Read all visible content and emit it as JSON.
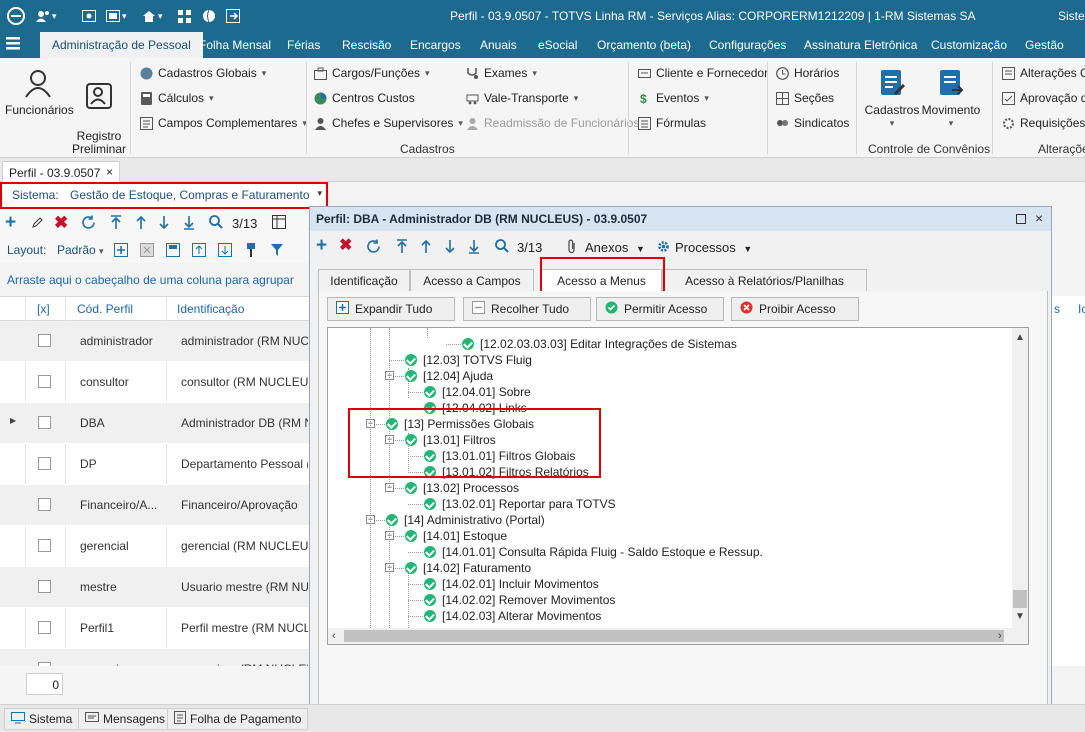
{
  "app": {
    "window_title": "Perfil - 03.9.0507 - TOTVS Linha RM - Serviços  Alias: CORPORERM1212209 | 1-RM Sistemas SA",
    "right_title": "Sister"
  },
  "menubar": {
    "items": [
      "Administração de Pessoal",
      "Folha Mensal",
      "Férias",
      "Rescisão",
      "Encargos",
      "Anuais",
      "eSocial",
      "Orçamento (beta)",
      "Configurações",
      "Assinatura Eletrônica",
      "Customização",
      "Gestão"
    ],
    "active": "Administração de Pessoal"
  },
  "ribbon": {
    "funcionarios": "Funcionários",
    "registro": "Registro\nPreliminar",
    "cadastros_globais": "Cadastros Globais",
    "calculos": "Cálculos",
    "campos_complementares": "Campos Complementares",
    "cargos": "Cargos/Funções",
    "centros_custos": "Centros Custos",
    "chefes": "Chefes e Supervisores",
    "exames": "Exames",
    "vale_transporte": "Vale-Transporte",
    "readmissao": "Readmissão de Funcionários",
    "cliente_fornecedor": "Cliente e Fornecedor",
    "eventos": "Eventos",
    "formulas": "Fórmulas",
    "horarios": "Horários",
    "secoes": "Seções",
    "sindicatos": "Sindicatos",
    "cadastros_big": "Cadastros",
    "movimento_big": "Movimento",
    "alteracoes_ca": "Alterações Ca",
    "aprovacao": "Aprovação de",
    "requisicoes": "Requisições",
    "group_cadastros": "Cadastros",
    "group_convenios": "Controle de Convênios",
    "group_alteracoes": "Alteraçõe"
  },
  "doc_tab": {
    "label": "Perfil - 03.9.0507",
    "close": "×"
  },
  "sistema": {
    "label": "Sistema:",
    "value": "Gestão de Estoque, Compras e Faturamento"
  },
  "left_toolbar": {
    "counter": "3/13",
    "layout_label": "Layout:",
    "layout_value": "Padrão"
  },
  "group_hint": "Arraste aqui o cabeçalho de uma coluna para agrupar",
  "grid": {
    "headers": {
      "check": "[x]",
      "code": "Cód. Perfil",
      "ident": "Identificação"
    },
    "rows": [
      {
        "code": "administrador",
        "ident": "administrador (RM NUCLEUS)"
      },
      {
        "code": "consultor",
        "ident": "consultor (RM NUCLEUS)"
      },
      {
        "code": "DBA",
        "ident": "Administrador DB (RM NUCLEUS)"
      },
      {
        "code": "DP",
        "ident": "Departamento Pessoal (RM NUCLEUS)"
      },
      {
        "code": "Financeiro/A...",
        "ident": "Financeiro/Aprovação"
      },
      {
        "code": "gerencial",
        "ident": "gerencial (RM NUCLEUS)"
      },
      {
        "code": "mestre",
        "ident": "Usuario mestre (RM NUCLEUS)"
      },
      {
        "code": "Perfil1",
        "ident": "Perfil mestre (RM NUCLEUS)"
      },
      {
        "code": "supervisor",
        "ident": "supervisor (RM NUCLEUS)"
      }
    ],
    "selected_row": 2,
    "footer_count": "0"
  },
  "right_strip": {
    "col1": "s",
    "col2": "Ic"
  },
  "statusbar": {
    "sistema": "Sistema",
    "mensagens": "Mensagens",
    "folha": "Folha de Pagamento"
  },
  "dialog": {
    "title": "Perfil: DBA - Administrador DB (RM NUCLEUS) - 03.9.0507",
    "counter": "3/13",
    "anexos": "Anexos",
    "processos": "Processos",
    "tabs": [
      "Identificação",
      "Acesso a Campos",
      "Acesso a Menus",
      "Acesso à Relatórios/Planilhas"
    ],
    "active_tab": "Acesso a Menus",
    "buttons": {
      "expandir": "Expandir Tudo",
      "recolher": "Recolher Tudo",
      "permitir": "Permitir Acesso",
      "proibir": "Proibir Acesso"
    },
    "tree": [
      {
        "label": "[12.02.03.03.03] Editar Integrações de Sistemas"
      },
      {
        "label": "[12.03] TOTVS Fluig"
      },
      {
        "label": "[12.04] Ajuda"
      },
      {
        "label": "[12.04.01] Sobre"
      },
      {
        "label": "[12.04.02] Links"
      },
      {
        "label": "[13] Permissões Globais"
      },
      {
        "label": "[13.01] Filtros"
      },
      {
        "label": "[13.01.01] Filtros Globais"
      },
      {
        "label": "[13.01.02] Filtros Relatórios"
      },
      {
        "label": "[13.02] Processos"
      },
      {
        "label": "[13.02.01] Reportar para TOTVS"
      },
      {
        "label": "[14] Administrativo (Portal)"
      },
      {
        "label": "[14.01] Estoque"
      },
      {
        "label": "[14.01.01] Consulta Rápida Fluig - Saldo Estoque e Ressup."
      },
      {
        "label": "[14.02] Faturamento"
      },
      {
        "label": "[14.02.01] Incluir Movimentos"
      },
      {
        "label": "[14.02.02] Remover Movimentos"
      },
      {
        "label": "[14.02.03] Alterar Movimentos"
      }
    ]
  },
  "colors": {
    "titlebar": "#1d6a8f",
    "highlight": "#e00000",
    "ok_green": "#22b573",
    "link_blue": "#1e66a8"
  }
}
